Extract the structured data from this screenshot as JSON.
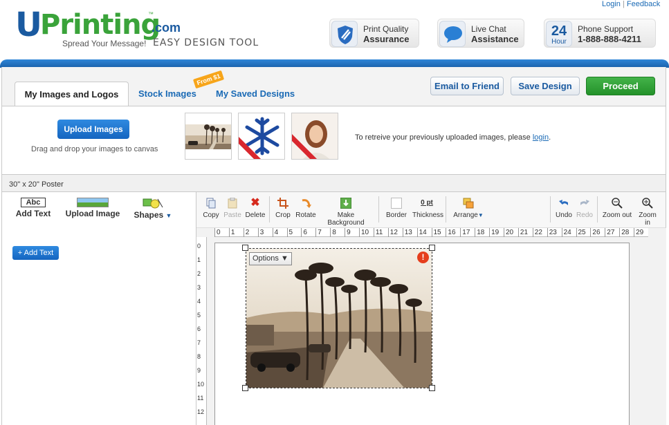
{
  "header": {
    "logo_u": "U",
    "logo_printing": "Printing",
    "logo_tm": "™",
    "logo_com": ".com",
    "tagline": "Spread Your Message!",
    "tool_name": "EASY DESIGN TOOL",
    "links": {
      "login": "Login",
      "separator": "|",
      "feedback": "Feedback"
    },
    "badges": [
      {
        "line1": "Print Quality",
        "line2": "Assurance",
        "icon": "shield-icon"
      },
      {
        "line1": "Live Chat",
        "line2": "Assistance",
        "icon": "chat-bubble-icon"
      },
      {
        "icon_big": "24",
        "icon_small": "Hour",
        "line1": "Phone Support",
        "line2": "1-888-888-4211"
      }
    ]
  },
  "tabs": {
    "active": "My Images and Logos",
    "stock": "Stock Images",
    "saved": "My Saved Designs",
    "ribbon": "From $1"
  },
  "actions": {
    "email": "Email to Friend",
    "save": "Save Design",
    "proceed": "Proceed"
  },
  "upload": {
    "button": "Upload Images",
    "hint": "Drag and drop your images to canvas",
    "retrieve_text": "To retreive your previously uploaded images, please",
    "retrieve_link": "login",
    "retrieve_end": "."
  },
  "poster_size": "30\" x 20\" Poster",
  "left_tools": {
    "abc": "Abc",
    "add_text": "Add Text",
    "upload_image": "Upload Image",
    "shapes": "Shapes",
    "add_text_button": "+ Add Text"
  },
  "toolbar": {
    "copy": "Copy",
    "paste": "Paste",
    "delete": "Delete",
    "crop": "Crop",
    "rotate": "Rotate",
    "make_background": "Make Background",
    "border": "Border",
    "thickness_value": "0 pt",
    "thickness": "Thickness",
    "arrange": "Arrange",
    "undo": "Undo",
    "redo": "Redo",
    "zoom_out": "Zoom out",
    "zoom_in": "Zoom in"
  },
  "ruler": {
    "top": [
      "0",
      "1",
      "2",
      "3",
      "4",
      "5",
      "6",
      "7",
      "8",
      "9",
      "10",
      "11",
      "12",
      "13",
      "14",
      "15",
      "16",
      "17",
      "18",
      "19",
      "20",
      "21",
      "22",
      "23",
      "24",
      "25",
      "26",
      "27",
      "28",
      "29"
    ],
    "left": [
      "0",
      "1",
      "2",
      "3",
      "4",
      "5",
      "6",
      "7",
      "8",
      "9",
      "10",
      "11",
      "12"
    ]
  },
  "canvas": {
    "options_label": "Options ▼",
    "warning": "!"
  },
  "colors": {
    "brand_blue": "#1a5aa0",
    "brand_green": "#3aa33a",
    "proceed_green": "#2ba231",
    "warning_red": "#e53e1c"
  }
}
